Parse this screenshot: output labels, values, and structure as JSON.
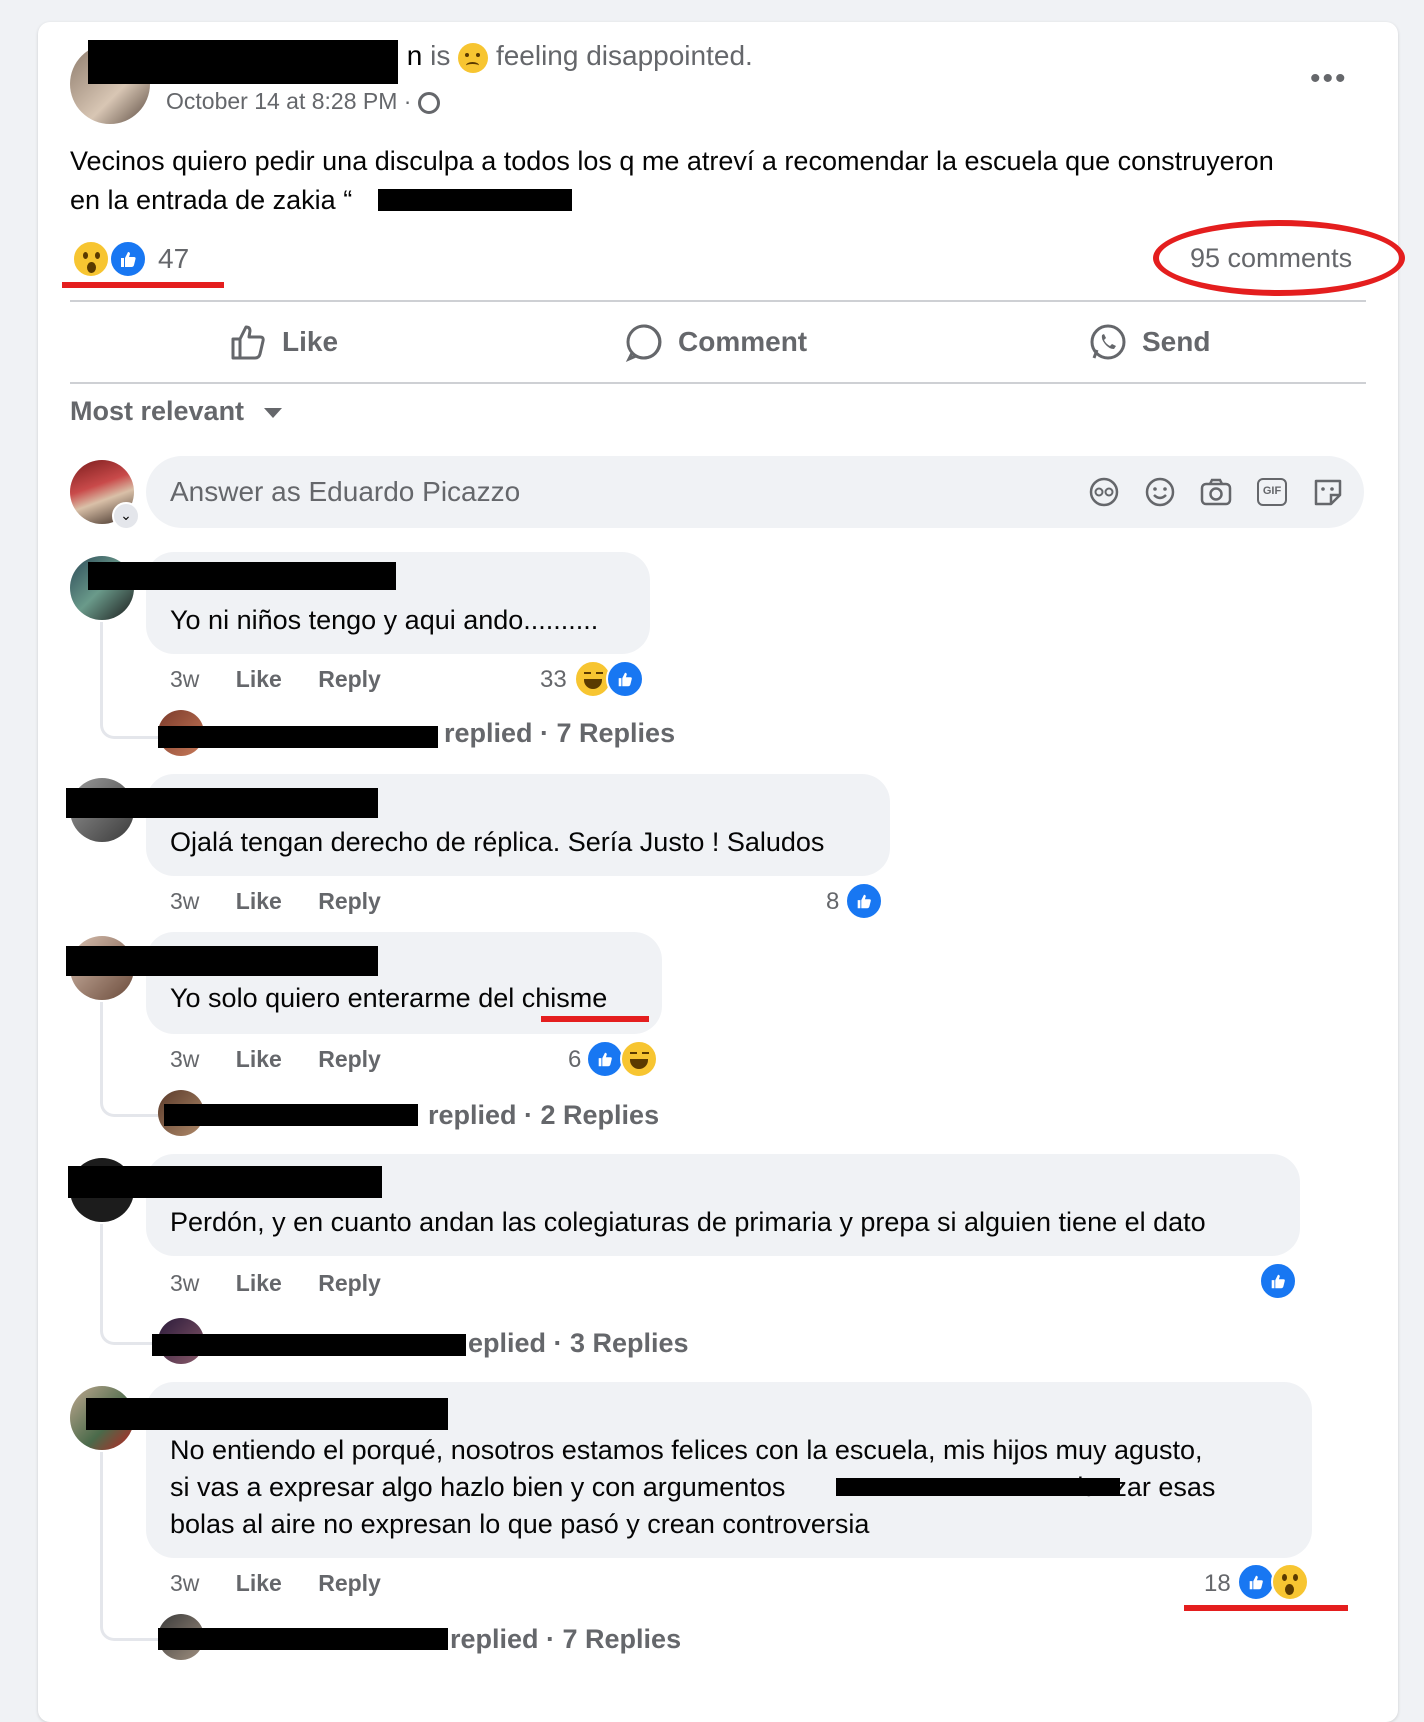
{
  "post": {
    "status_is": "is",
    "feeling": "feeling disappointed.",
    "timestamp": "October 14 at 8:28 PM",
    "separator": "·",
    "text_line1": "Vecinos quiero pedir una disculpa a todos los q me atreví a recomendar la escuela que construyeron",
    "text_line2": "en la entrada de zakia “",
    "reaction_count": "47",
    "comments_count": "95 comments",
    "more_label": "•••"
  },
  "actions": {
    "like": "Like",
    "comment": "Comment",
    "send": "Send"
  },
  "sort": {
    "label": "Most relevant"
  },
  "composer": {
    "placeholder": "Answer as Eduardo Picazzo",
    "gif_label": "GIF"
  },
  "comments": [
    {
      "text": "Yo ni niños tengo y aqui ando..........",
      "time": "3w",
      "like": "Like",
      "reply": "Reply",
      "reaction_count": "33",
      "replied_text": "replied · 7 Replies"
    },
    {
      "text": "Ojalá tengan derecho de réplica. Sería Justo ! Saludos",
      "time": "3w",
      "like": "Like",
      "reply": "Reply",
      "reaction_count": "8"
    },
    {
      "text": "Yo solo quiero enterarme del chisme",
      "time": "3w",
      "like": "Like",
      "reply": "Reply",
      "reaction_count": "6",
      "replied_text": "replied · 2 Replies"
    },
    {
      "text": "Perdón, y en cuanto andan las colegiaturas de primaria y prepa si alguien tiene el dato",
      "time": "3w",
      "like": "Like",
      "reply": "Reply",
      "replied_text": "eplied · 3 Replies"
    },
    {
      "text_line1": "No entiendo el porqué, nosotros estamos felices con la escuela, mis hijos muy agusto,",
      "text_line2a": "si vas a expresar algo hazlo bien y con argumentos",
      "text_line2b": "lanzar esas",
      "text_line3": "bolas al aire no expresan lo que pasó y crean controversia",
      "time": "3w",
      "like": "Like",
      "reply": "Reply",
      "reaction_count": "18",
      "replied_text": "replied · 7 Replies"
    }
  ],
  "colors": {
    "accent_blue": "#1877f2",
    "annotation_red": "#e41e1e",
    "secondary_text": "#65676b",
    "bubble_bg": "#f0f2f5"
  }
}
